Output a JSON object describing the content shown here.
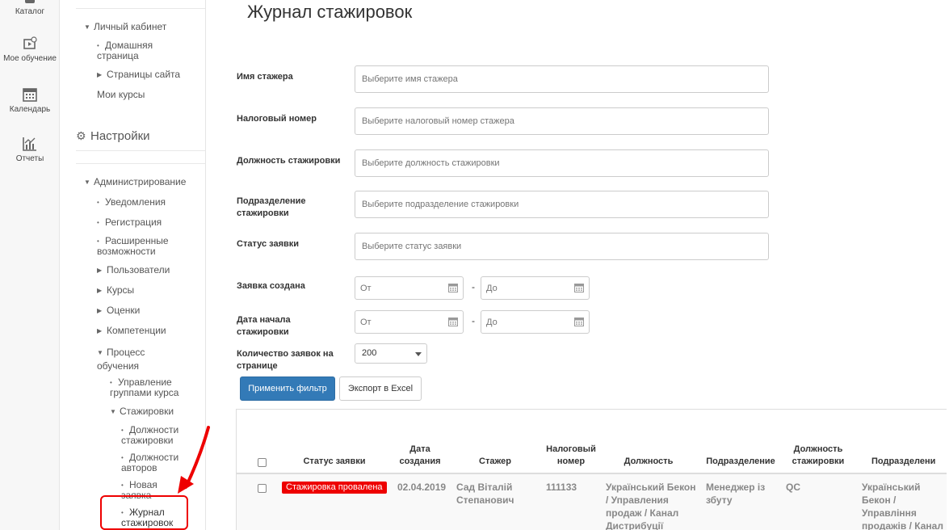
{
  "rail": {
    "items": [
      {
        "label": "Каталог",
        "icon": "catalog-icon"
      },
      {
        "label": "Мое обучение",
        "icon": "my-learning-icon"
      },
      {
        "label": "Календарь",
        "icon": "calendar-icon"
      },
      {
        "label": "Отчеты",
        "icon": "reports-icon"
      }
    ]
  },
  "sidebar": {
    "account": "Личный кабинет",
    "home_page": "Домашняя страница",
    "site_pages": "Страницы сайта",
    "my_courses": "Мои курсы",
    "settings": "Настройки",
    "administration": "Администрирование",
    "notifications": "Уведомления",
    "registration": "Регистрация",
    "advanced": "Расширенные возможности",
    "users": "Пользователи",
    "courses": "Курсы",
    "grades": "Оценки",
    "competencies": "Компетенции",
    "learning_process": "Процесс обучения",
    "course_groups": "Управление группами курса",
    "internships": "Стажировки",
    "internship_positions": "Должности стажировки",
    "author_positions": "Должности авторов",
    "new_request": "Новая заявка",
    "internship_journal": "Журнал стажировок"
  },
  "main": {
    "title": "Журнал стажировок",
    "filters": {
      "intern_name_label": "Имя стажера",
      "intern_name_placeholder": "Выберите имя стажера",
      "tax_number_label": "Налоговый номер",
      "tax_number_placeholder": "Выберите налоговый номер стажера",
      "position_label": "Должность стажировки",
      "position_placeholder": "Выберите должность стажировки",
      "department_label": "Подразделение стажировки",
      "department_placeholder": "Выберите подразделение стажировки",
      "status_label": "Статус заявки",
      "status_placeholder": "Выберите статус заявки",
      "created_label": "Заявка создана",
      "start_label": "Дата начала стажировки",
      "from_placeholder": "От",
      "to_placeholder": "До",
      "dash": "-",
      "per_page_label": "Количество заявок на странице",
      "per_page_value": "200",
      "apply_button": "Применить фильтр",
      "export_button": "Экспорт в Excel"
    },
    "table": {
      "headers": {
        "status": "Статус заявки",
        "created": "Дата создания",
        "intern": "Стажер",
        "tax_number": "Налоговый номер",
        "position": "Должность",
        "department": "Подразделение",
        "internship_position": "Должность стажировки",
        "internship_department": "Подразделени"
      },
      "rows": [
        {
          "status": "Стажировка провалена",
          "created": "02.04.2019",
          "intern": "Сад Віталій Степанович",
          "tax_number": "111133",
          "position": "Український Бекон / Управления продаж / Канал Дистрибуції",
          "department": "Менеджер із збуту",
          "internship_position": "QC",
          "internship_department": "Український Бекон / Управління продажів / Канал Дистрибуції"
        }
      ]
    }
  },
  "colors": {
    "primary": "#337ab7",
    "danger_badge": "#ee0000",
    "annotation": "#ee0000"
  }
}
